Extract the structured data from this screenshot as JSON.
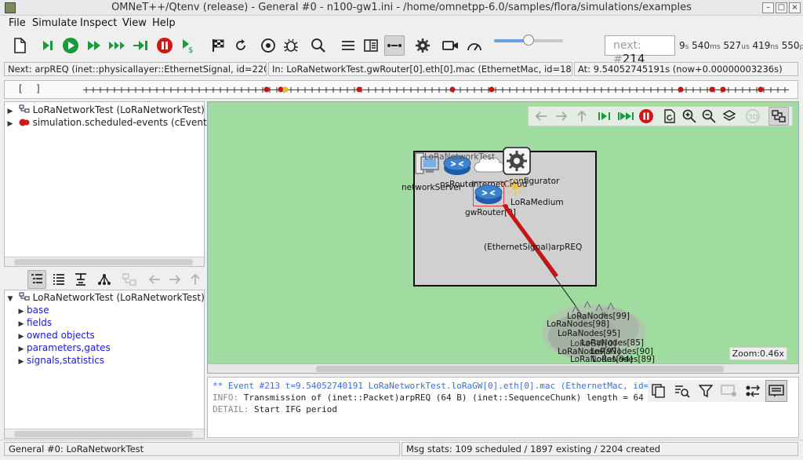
{
  "window": {
    "title": "OMNeT++/Qtenv (release) - General #0 - n100-gw1.ini - /home/omnetpp-6.0/samples/flora/simulations/examples"
  },
  "menu": [
    "File",
    "Simulate",
    "Inspect",
    "View",
    "Help"
  ],
  "toolbar": {
    "next_label": "next: #",
    "next_event": "214",
    "time": {
      "s": "9",
      "ms": "540",
      "us": "527",
      "ns": "419",
      "ps": "550"
    }
  },
  "status": {
    "next": "Next: arpREQ (inet::physicallayer::EthernetSignal, id=2201)",
    "in": "In: LoRaNetworkTest.gwRouter[0].eth[0].mac (EthernetMac, id=1886)",
    "at": "At: 9.54052745191s (now+0.00000003236s)"
  },
  "timeline": {
    "open": "[",
    "close": "]"
  },
  "object_tree": [
    {
      "label": "LoRaNetworkTest (LoRaNetworkTest)",
      "suffix": "id"
    },
    {
      "label": "simulation.scheduled-events (cEventHe",
      "suffix": ""
    }
  ],
  "inspector": {
    "root": "LoRaNetworkTest (LoRaNetworkTest)",
    "root_suffix": "id",
    "children": [
      "base",
      "fields",
      "owned objects",
      "parameters,gates",
      "signals,statistics"
    ]
  },
  "canvas": {
    "zoom": "Zoom:0.46x",
    "labels": {
      "network_server": "networkServer",
      "ns_router": "nsRouter",
      "internet_cloud": "internetCloud",
      "configurator": "configurator",
      "lora_medium": "LoRaMedium",
      "gw_router": "gwRouter[0]",
      "message": "(EthernetSignal)arpREQ",
      "visible_network_name": "LoRaNetworkTest",
      "lora_gw": "LoRaGW[0]"
    },
    "node_labels": [
      "LoRaNodes[99]",
      "LoRaNodes[98]",
      "LoRaNodes[95]",
      "LoRaNodes[85]",
      "LoRaNodes[90]",
      "LoRaNodes[97]",
      "LoRaNodes[94]",
      "LoRaNodes[89]"
    ]
  },
  "log": {
    "event_line": "** Event #213  t=9.54052740191  LoRaNetworkTest.loRaGW[0].eth[0].mac (EthernetMac, id=",
    "info_level": "INFO:",
    "info_text": "Transmission of (inet::Packet)arpREQ (64 B) (inet::SequenceChunk) length = 64 B",
    "detail_level": "DETAIL:",
    "detail_text": "Start IFG period"
  },
  "statusbar": {
    "left": "General #0: LoRaNetworkTest",
    "right": "Msg stats: 109 scheduled / 1897 existing / 2204 created"
  }
}
